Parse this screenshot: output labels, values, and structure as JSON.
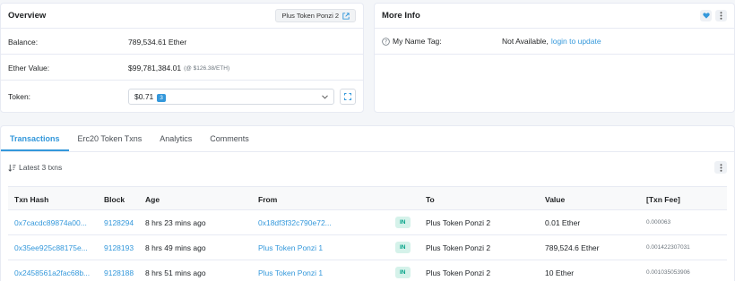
{
  "overview": {
    "title": "Overview",
    "tag_label": "Plus Token Ponzi 2",
    "balance_label": "Balance:",
    "balance_value": "789,534.61 Ether",
    "ether_value_label": "Ether Value:",
    "ether_value": "$99,781,384.01",
    "ether_price": "(@ $126.38/ETH)",
    "token_label": "Token:",
    "token_value": "$0.71",
    "token_count": "3"
  },
  "more_info": {
    "title": "More Info",
    "name_tag_label": "My Name Tag:",
    "name_tag_value": "Not Available,",
    "name_tag_link": "login to update"
  },
  "tabs": [
    {
      "label": "Transactions",
      "active": true
    },
    {
      "label": "Erc20 Token Txns",
      "active": false
    },
    {
      "label": "Analytics",
      "active": false
    },
    {
      "label": "Comments",
      "active": false
    }
  ],
  "txns_summary": "Latest 3 txns",
  "table": {
    "headers": [
      "Txn Hash",
      "Block",
      "Age",
      "From",
      "To",
      "Value",
      "[Txn Fee]"
    ],
    "rows": [
      {
        "hash": "0x7cacdc89874a00...",
        "block": "9128294",
        "age": "8 hrs 23 mins ago",
        "from": "0x18df3f32c790e72...",
        "dir": "IN",
        "to": "Plus Token Ponzi 2",
        "value": "0.01 Ether",
        "fee": "0.000063"
      },
      {
        "hash": "0x35ee925c88175e...",
        "block": "9128193",
        "age": "8 hrs 49 mins ago",
        "from": "Plus Token Ponzi 1",
        "dir": "IN",
        "to": "Plus Token Ponzi 2",
        "value": "789,524.6 Ether",
        "fee": "0.001422307031"
      },
      {
        "hash": "0x2458561a2fac68b...",
        "block": "9128188",
        "age": "8 hrs 51 mins ago",
        "from": "Plus Token Ponzi 1",
        "dir": "IN",
        "to": "Plus Token Ponzi 2",
        "value": "10 Ether",
        "fee": "0.001035053906"
      }
    ]
  },
  "colors": {
    "accent": "#3498db",
    "in_badge_bg": "#d5f2ea",
    "in_badge_text": "#00a186"
  }
}
